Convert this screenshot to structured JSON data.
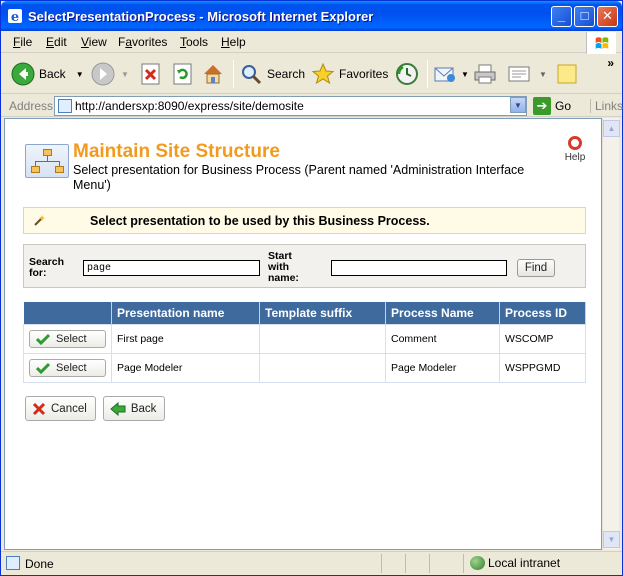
{
  "window": {
    "title": "SelectPresentationProcess - Microsoft Internet Explorer",
    "minimize_glyph": "_",
    "maximize_glyph": "□",
    "close_glyph": "✕"
  },
  "menu": {
    "items": [
      {
        "label": "File",
        "key": "F",
        "rest": "ile"
      },
      {
        "label": "Edit",
        "key": "E",
        "rest": "dit"
      },
      {
        "label": "View",
        "key": "V",
        "rest": "iew"
      },
      {
        "label": "Favorites",
        "key": "a",
        "pre": "F",
        "rest": "vorites"
      },
      {
        "label": "Tools",
        "key": "T",
        "rest": "ools"
      },
      {
        "label": "Help",
        "key": "H",
        "rest": "elp"
      }
    ]
  },
  "toolbar": {
    "back_label": "Back",
    "search_label": "Search",
    "favorites_label": "Favorites",
    "overflow": "»"
  },
  "address": {
    "label": "Address",
    "url": "http://andersxp:8090/express/site/demosite",
    "go_label": "Go",
    "links_label": "Links"
  },
  "page": {
    "title": "Maintain Site Structure",
    "subtitle": "Select presentation for Business Process (Parent named 'Administration Interface Menu')",
    "help_label": "Help",
    "notice": "Select presentation to be used by this Business Process.",
    "search": {
      "search_for_label_1": "Search",
      "search_for_label_2": "for:",
      "search_for_value": "page",
      "start_with_label_1": "Start",
      "start_with_label_2": "with",
      "start_with_label_3": "name:",
      "start_with_value": "",
      "find_label": "Find"
    },
    "table": {
      "columns": [
        "",
        "Presentation name",
        "Template suffix",
        "Process Name",
        "Process ID"
      ],
      "select_label": "Select",
      "rows": [
        {
          "presentation": "First page",
          "suffix": "",
          "process": "Comment",
          "id": "WSCOMP"
        },
        {
          "presentation": "Page Modeler",
          "suffix": "",
          "process": "Page Modeler",
          "id": "WSPPGMD"
        }
      ]
    },
    "cancel_label": "Cancel",
    "back_label": "Back"
  },
  "status": {
    "text": "Done",
    "zone": "Local intranet"
  },
  "colors": {
    "title_orange": "#f29a1e",
    "table_header": "#3e6a9e",
    "notice_bg": "#fffbe6",
    "xp_blue": "#0053ee"
  }
}
